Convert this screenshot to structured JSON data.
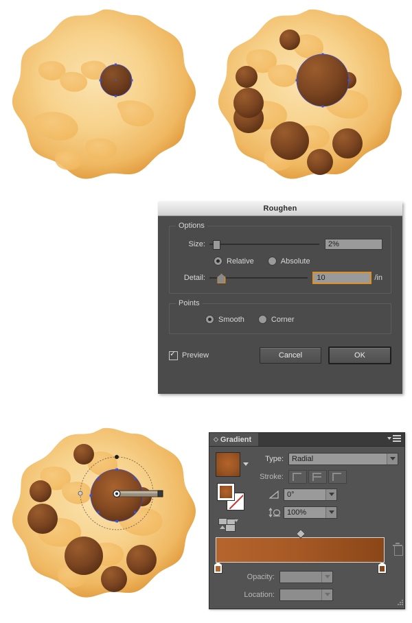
{
  "artwork": {
    "cookie1": {
      "name": "cookie-single-chip-selected",
      "base_color": "#F7D28C",
      "edge_color": "#E09B3C",
      "chip_color": "#6E3C1C",
      "selection_color": "#3A53D8",
      "description": "Cookie with one chocolate chip selected"
    },
    "cookie2": {
      "name": "cookie-many-chips",
      "description": "Cookie with many chocolate chips, one selected"
    },
    "cookie3": {
      "name": "cookie-gradient-annotator",
      "description": "Cookie with radial gradient annotator on a chip"
    }
  },
  "dialog": {
    "title": "Roughen",
    "options": {
      "legend": "Options",
      "size_label": "Size:",
      "size_value": "2%",
      "size_slider_pct": 3,
      "relative_label": "Relative",
      "absolute_label": "Absolute",
      "size_mode": "Relative",
      "detail_label": "Detail:",
      "detail_value": "10",
      "detail_unit": "/in",
      "detail_slider_pct": 8
    },
    "points": {
      "legend": "Points",
      "smooth_label": "Smooth",
      "corner_label": "Corner",
      "selected": "Smooth"
    },
    "preview_label": "Preview",
    "preview_checked": true,
    "cancel_label": "Cancel",
    "ok_label": "OK"
  },
  "gradient_panel": {
    "tab_label": "Gradient",
    "type_label": "Type:",
    "type_value": "Radial",
    "stroke_label": "Stroke:",
    "angle_value": "0°",
    "aspect_value": "100%",
    "opacity_label": "Opacity:",
    "opacity_value": "",
    "location_label": "Location:",
    "location_value": "",
    "gradient_start_color": "#B5652C",
    "gradient_end_color": "#8A4618",
    "stop_left_pct": 0,
    "stop_right_pct": 100,
    "midpoint_pct": 50
  }
}
